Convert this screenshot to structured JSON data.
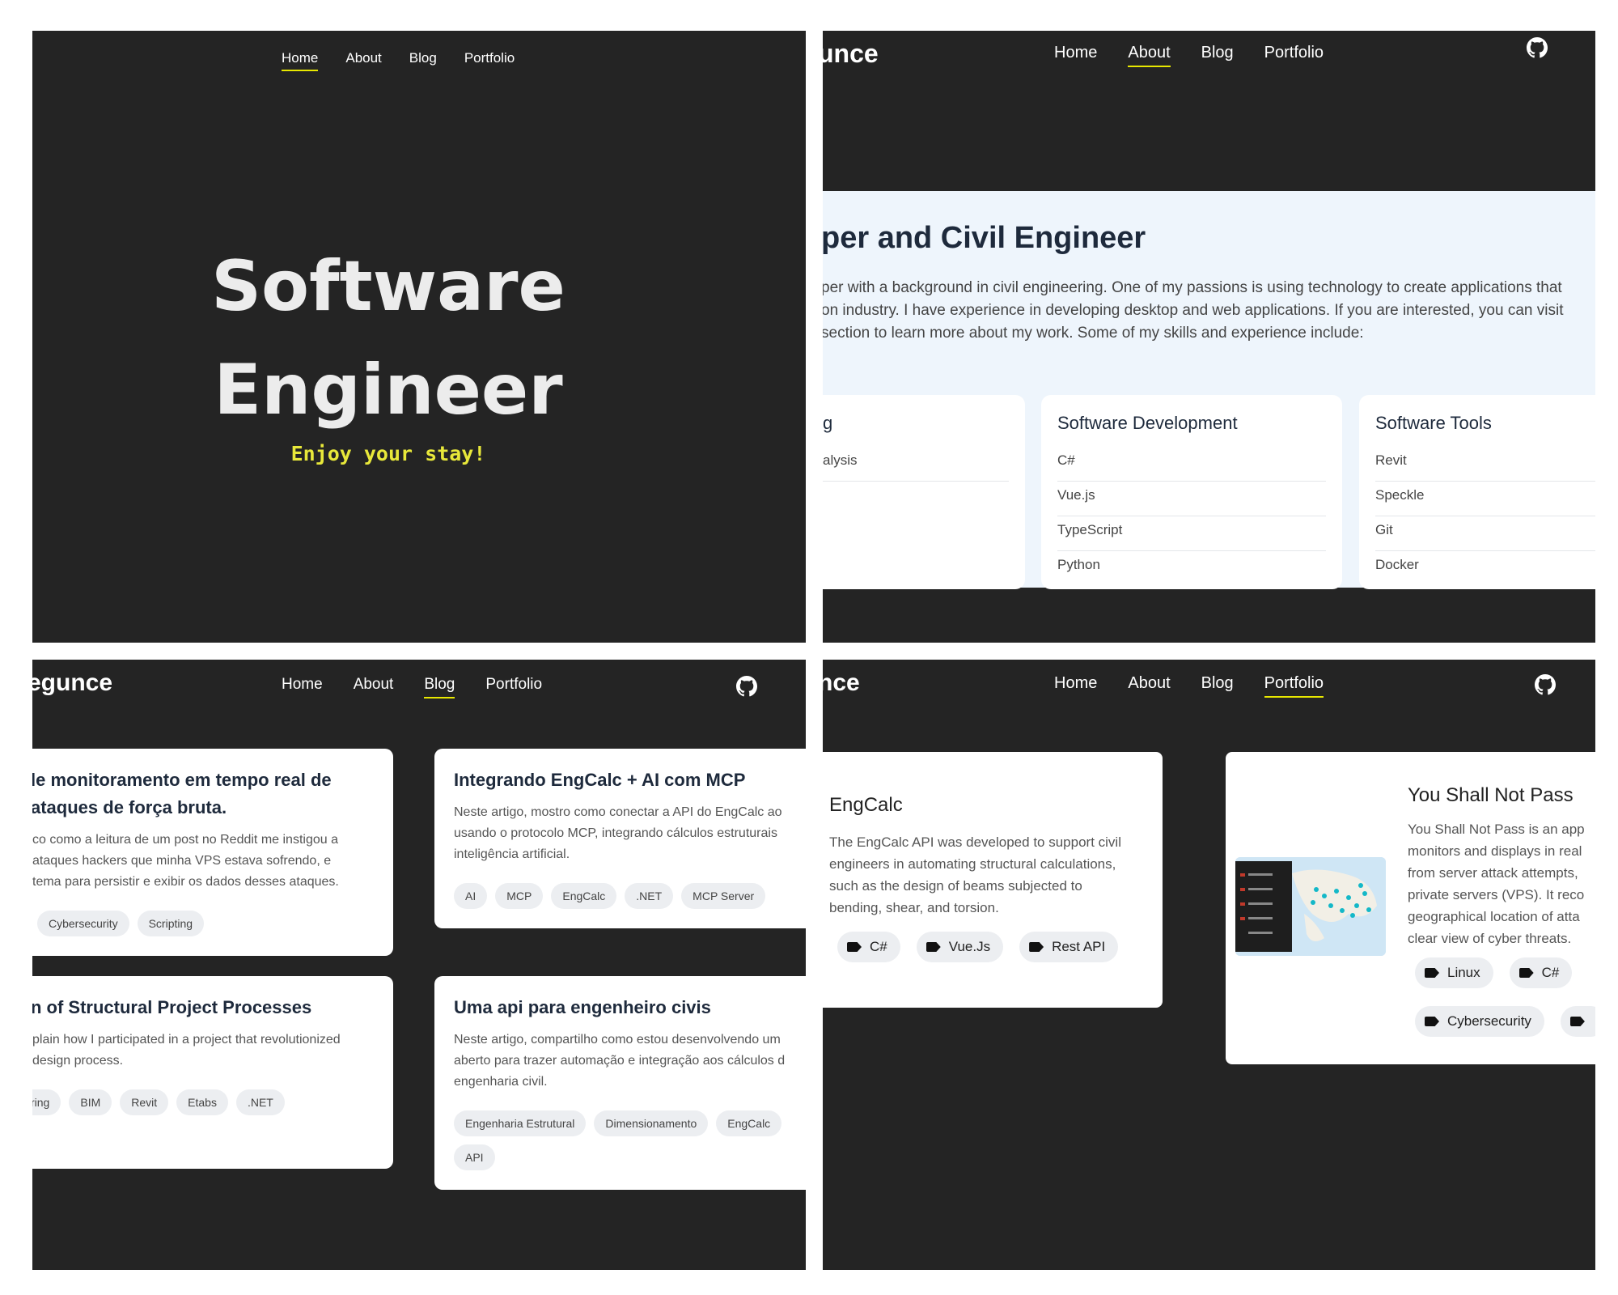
{
  "nav": [
    "Home",
    "About",
    "Blog",
    "Portfolio"
  ],
  "brand_partial_about": "unce",
  "brand_partial_blog": "egunce",
  "brand_partial_portfolio": "nce",
  "hero": {
    "title_line1": "Software",
    "title_line2": "Engineer",
    "subtitle": "Enjoy your stay!"
  },
  "about": {
    "heading": "per and Civil Engineer",
    "paragraph": [
      "per with a background in civil engineering. One of my passions is using technology to create applications that",
      "on industry. I have experience in developing desktop and web applications. If you are interested, you can visit",
      "section to learn more about my work. Some of my skills and experience include:"
    ],
    "skills": [
      {
        "title": "g",
        "items": [
          "alysis",
          ""
        ]
      },
      {
        "title": "Software Development",
        "items": [
          "C#",
          "Vue.js",
          "TypeScript",
          "Python"
        ]
      },
      {
        "title": "Software Tools",
        "items": [
          "Revit",
          "Speckle",
          "Git",
          "Docker"
        ]
      }
    ]
  },
  "blog": {
    "posts": [
      {
        "title": [
          "le monitoramento em tempo real de",
          "ataques de força bruta."
        ],
        "desc": [
          "co como a leitura de um post no Reddit me instigou a",
          "ataques hackers que minha VPS estava sofrendo, e",
          "tema para persistir e exibir os dados desses ataques."
        ],
        "tags": [
          "Cybersecurity",
          "Scripting"
        ]
      },
      {
        "title": [
          "Integrando EngCalc + AI com MCP"
        ],
        "desc": [
          "Neste artigo, mostro como conectar a API do EngCalc ao",
          "usando o protocolo MCP, integrando cálculos estruturais",
          "inteligência artificial."
        ],
        "tags": [
          "AI",
          "MCP",
          "EngCalc",
          ".NET",
          "MCP Server"
        ]
      },
      {
        "title": [
          "n of Structural Project Processes"
        ],
        "desc": [
          "plain how I participated in a project that revolutionized",
          " design process."
        ],
        "tags": [
          "ring",
          "BIM",
          "Revit",
          "Etabs",
          ".NET"
        ]
      },
      {
        "title": [
          "Uma api para engenheiro civis"
        ],
        "desc": [
          "Neste artigo, compartilho como estou desenvolvendo um",
          "aberto para trazer automação e integração aos cálculos d",
          "engenharia civil."
        ],
        "tags": [
          "Engenharia Estrutural",
          "Dimensionamento",
          "EngCalc",
          "API"
        ]
      }
    ]
  },
  "portfolio": {
    "projects": [
      {
        "title": "EngCalc",
        "desc": [
          "The EngCalc API was developed to support civil",
          "engineers in automating structural calculations,",
          "such as the design of beams subjected to",
          "bending, shear, and torsion."
        ],
        "tags": [
          "C#",
          "Vue.Js",
          "Rest API"
        ]
      },
      {
        "title": "You Shall Not Pass",
        "desc": [
          "You Shall Not Pass is an app",
          "monitors and displays in real",
          "from server attack attempts,",
          "private servers (VPS). It reco",
          "geographical location of atta",
          "clear view of cyber threats."
        ],
        "tags": [
          "Linux",
          "C#",
          "Cybersecurity",
          ""
        ]
      }
    ]
  },
  "colors": {
    "dark_bg": "#242424",
    "accent": "#e8e800",
    "light_band": "#eef5fc"
  }
}
